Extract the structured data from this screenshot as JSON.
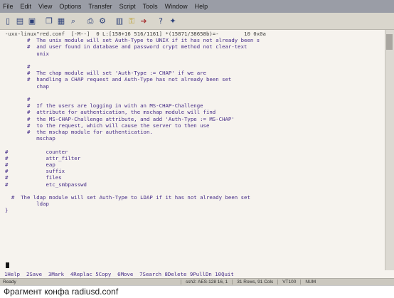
{
  "menubar": [
    "File",
    "Edit",
    "View",
    "Options",
    "Transfer",
    "Script",
    "Tools",
    "Window",
    "Help"
  ],
  "toolbar_icons": [
    "new-icon",
    "open-icon",
    "save-icon",
    "sep",
    "copy-icon",
    "paste-icon",
    "find-icon",
    "sep",
    "print-icon",
    "options-icon",
    "sep",
    "session-icon",
    "key-icon",
    "arrow-icon",
    "sep",
    "help-icon",
    "about-icon"
  ],
  "editor": {
    "lines": [
      "-uxx-linux\"red.conf  [-M--]  0 L:[158+16 516/1161] *(15871/38658b)=-        10 0x0a",
      "       #  The unix module will set Auth-Type to UNIX if it has not already been s",
      "       #  and user found in database and password crypt method not clear-text",
      "          unix",
      "",
      "       #",
      "       #  The chap module will set 'Auth-Type := CHAP' if we are",
      "       #  handling a CHAP request and Auth-Type has not already been set",
      "          chap",
      "",
      "       #",
      "       #  If the users are logging in with an MS-CHAP-Challenge",
      "       #  attribute for authentication, the mschap module will find",
      "       #  the MS-CHAP-Challenge attribute, and add 'Auth-Type := MS-CHAP'",
      "       #  to the request, which will cause the server to then use",
      "       #  the mschap module for authentication.",
      "          mschap",
      "",
      "#            counter",
      "#            attr_filter",
      "#            eap",
      "#            suffix",
      "#            files",
      "#            etc_smbpasswd",
      "",
      "  #  The ldap module will set Auth-Type to LDAP if it has not already been set",
      "          ldap",
      "}"
    ],
    "function_keys": "1Help  2Save  3Mark  4Replac 5Copy  6Move  7Search 8Delete 9PullDn 10Quit"
  },
  "statusbar": {
    "left": "Ready",
    "cells": [
      "ssh2: AES-128   16,  1",
      "31 Rows, 91 Cols",
      "VT100",
      "NUM"
    ]
  },
  "caption": "Фрагмент конфа radiusd.conf"
}
